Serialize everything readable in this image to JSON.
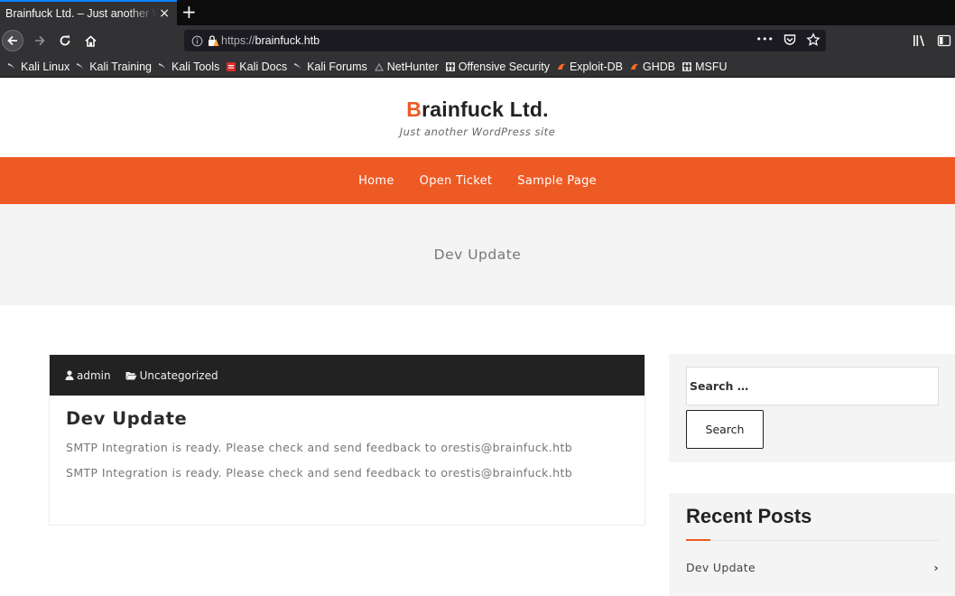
{
  "browser": {
    "tab_title": "Brainfuck Ltd. – Just another WordPress site",
    "tab_close": "×",
    "new_tab": "+",
    "url_scheme": "https://",
    "url_host": "brainfuck.htb",
    "page_actions": "•••",
    "bookmarks": [
      {
        "label": "Kali Linux",
        "icon": "kali-dragon-icon"
      },
      {
        "label": "Kali Training",
        "icon": "kali-dragon-icon"
      },
      {
        "label": "Kali Tools",
        "icon": "kali-dragon-icon"
      },
      {
        "label": "Kali Docs",
        "icon": "kali-docs-icon"
      },
      {
        "label": "Kali Forums",
        "icon": "kali-dragon-icon"
      },
      {
        "label": "NetHunter",
        "icon": "nethunter-icon"
      },
      {
        "label": "Offensive Security",
        "icon": "offsec-icon"
      },
      {
        "label": "Exploit-DB",
        "icon": "exploitdb-icon"
      },
      {
        "label": "GHDB",
        "icon": "exploitdb-icon"
      },
      {
        "label": "MSFU",
        "icon": "offsec-icon"
      }
    ]
  },
  "site": {
    "title_first": "B",
    "title_rest": "rainfuck Ltd.",
    "tagline": "Just another WordPress site",
    "menu": [
      "Home",
      "Open Ticket",
      "Sample Page"
    ],
    "banner_title": "Dev Update"
  },
  "post": {
    "author": "admin",
    "category": "Uncategorized",
    "title": "Dev Update",
    "paragraphs": [
      "SMTP Integration is ready. Please check and send feedback to orestis@brainfuck.htb",
      "SMTP Integration is ready. Please check and send feedback to orestis@brainfuck.htb"
    ]
  },
  "sidebar": {
    "search_placeholder": "Search …",
    "search_button": "Search",
    "recent_title": "Recent Posts",
    "recent_items": [
      "Dev Update"
    ]
  },
  "colors": {
    "accent": "#ee5a24",
    "dark": "#222222",
    "banner_bg": "#f4f4f4"
  }
}
